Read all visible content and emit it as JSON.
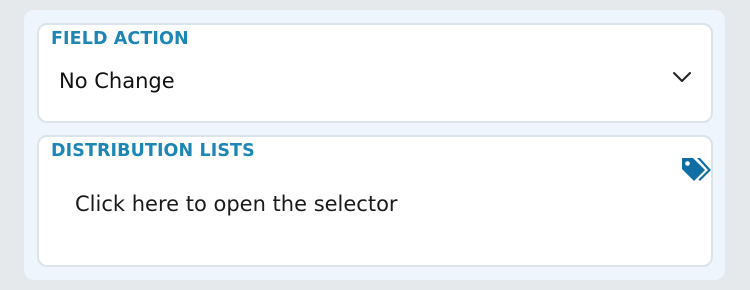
{
  "field_action": {
    "label": "FIELD ACTION",
    "selected_value": "No Change",
    "icon": "chevron-down-icon"
  },
  "distribution_lists": {
    "label": "DISTRIBUTION LISTS",
    "placeholder": "Click here to open the selector",
    "icon": "tags-icon"
  },
  "colors": {
    "label": "#1d86b5",
    "tag_icon": "#0f6fa5",
    "panel_bg": "#eef5fc",
    "page_bg": "#e6e9ec"
  }
}
